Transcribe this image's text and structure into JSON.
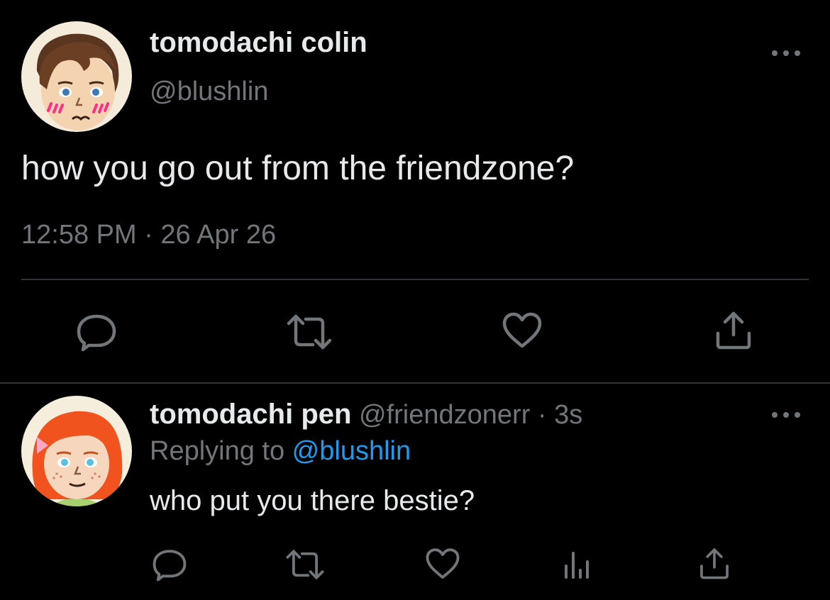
{
  "main_tweet": {
    "display_name": "tomodachi colin",
    "handle": "@blushlin",
    "text": "how you go out from the friendzone?",
    "timestamp": "12:58 PM · 26 Apr 26",
    "avatar_icon": "tomodachi-boy-avatar"
  },
  "reply_tweet": {
    "display_name": "tomodachi pen",
    "handle": "@friendzonerr",
    "separator": " · ",
    "time_ago": "3s",
    "replying_prefix": "Replying to ",
    "replying_to": "@blushlin",
    "text": "who put you there bestie?",
    "avatar_icon": "tomodachi-girl-avatar"
  },
  "icons": {
    "more": "more-horizontal-icon",
    "reply": "speech-bubble-icon",
    "retweet": "retweet-arrows-icon",
    "like": "heart-icon",
    "share": "share-upload-icon",
    "analytics": "bar-chart-icon"
  },
  "colors": {
    "background": "#000000",
    "text_primary": "#e7e9ea",
    "text_secondary": "#71767b",
    "link": "#1d9bf0",
    "divider": "#2f3336"
  }
}
